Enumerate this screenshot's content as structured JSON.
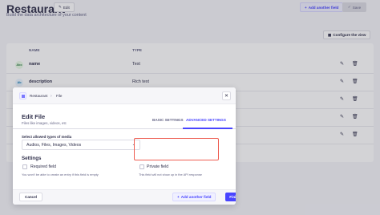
{
  "page": {
    "title": "Restaurant",
    "subtitle": "Build the data architecture of your content",
    "edit_label": "Edit",
    "add_another_field_label": "Add another field",
    "save_label": "Save",
    "configure_view_label": "Configure the view",
    "table": {
      "headers": [
        "NAME",
        "TYPE"
      ],
      "rows": [
        {
          "badge": "Abc",
          "name": "name",
          "type": "Text",
          "badge_color": "#eafbe7",
          "badge_text_color": "#328048"
        },
        {
          "badge": "Ab",
          "name": "description",
          "type": "Rich text",
          "badge_color": "#eaf5ff",
          "badge_text_color": "#0c75af"
        },
        {
          "badge": "",
          "name": "",
          "type": "",
          "badge_color": "#ffffff",
          "badge_text_color": "#ffffff"
        },
        {
          "badge": "",
          "name": "",
          "type": "",
          "badge_color": "#ffffff",
          "badge_text_color": "#ffffff"
        },
        {
          "badge": "",
          "name": "",
          "type": "",
          "badge_color": "#ffffff",
          "badge_text_color": "#ffffff"
        }
      ]
    }
  },
  "modal": {
    "breadcrumb": [
      "Restaurant",
      "File"
    ],
    "title": "Edit File",
    "subtitle": "Files like images, videos, etc",
    "tabs": {
      "basic": "BASIC SETTINGS",
      "advanced": "ADVANCED SETTINGS"
    },
    "select_label": "Select allowed types of media",
    "select_value": "Audios, Files, Images, Videos",
    "settings_heading": "Settings",
    "required": {
      "label": "Required field",
      "hint": "You won't be able to create an entry if this field is empty",
      "checked": false
    },
    "private": {
      "label": "Private field",
      "hint": "This field will not show up in the API response",
      "checked": false
    },
    "footer": {
      "cancel": "Cancel",
      "add_another": "Add another field",
      "finish": "Finish"
    }
  },
  "colors": {
    "primary": "#4945ff",
    "highlight": "#ee5e52"
  }
}
